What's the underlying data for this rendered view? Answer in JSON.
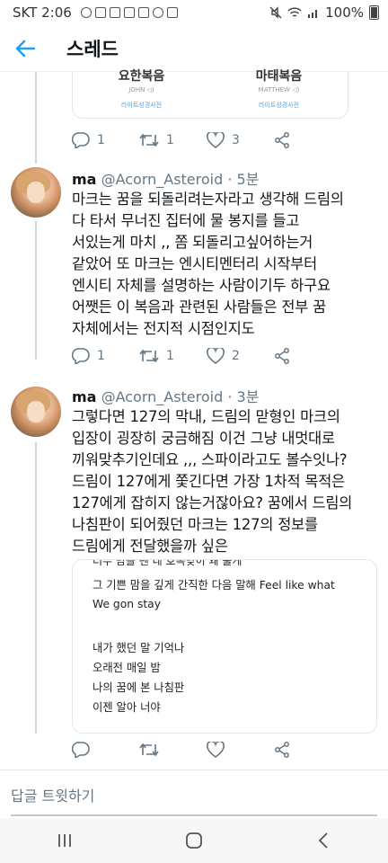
{
  "status_bar": {
    "carrier_time": "SKT 2:06",
    "battery_text": "100%",
    "icons_left": [
      "cloud-icon",
      "mail-icon",
      "calendar-icon",
      "cake-icon",
      "calendar-icon",
      "settings-icon",
      "gallery-icon"
    ],
    "icons_right": [
      "mute-icon",
      "wifi-icon",
      "signal-icon",
      "battery-icon"
    ]
  },
  "header": {
    "title": "스레드"
  },
  "prev_card": {
    "left": {
      "title": "요한복음",
      "sub": "JOHN ◁)",
      "link": "라이트성경사전"
    },
    "right": {
      "title": "마태복음",
      "sub": "MATTHEW ◁)",
      "link": "라이트성경사전"
    }
  },
  "actions_1": {
    "replies": "1",
    "retweets": "1",
    "likes": "3"
  },
  "tweet_1": {
    "name": "ma",
    "handle": "@Acorn_Asteroid",
    "dot": "·",
    "time": "5분",
    "lines": [
      "마크는 꿈을 되돌리려는자라고 생각해 드림의",
      "다 타서 무너진 집터에 물 봉지를 들고",
      "서있는게 마치 ,, 쫌 되돌리고싶어하는거",
      "같았어 또 마크는 엔시티멘터리 시작부터",
      "엔시티 자체를 설명하는 사람이기두 하구요",
      "어쨋든 이 복음과 관련된 사람들은 전부 꿈",
      "자체에서는 전지적 시점인지도"
    ]
  },
  "actions_2": {
    "replies": "1",
    "retweets": "1",
    "likes": "2"
  },
  "tweet_2": {
    "name": "ma",
    "handle": "@Acorn_Asteroid",
    "dot": "·",
    "time": "3분",
    "lines": [
      "그렇다면 127의 막내, 드림의 맏형인 마크의",
      "입장이 굉장히 궁금해짐 이건 그냥 내멋대로",
      "끼워맞추기인데요 ,,, 스파이라고도 볼수잇나?",
      "드림이 127에게 쫓긴다면 가장 1차적 목적은",
      "127에게 잡히지 않는거잖아요? 꿈에서 드림의",
      "나침판이 되어줬던 마크는 127의 정보를",
      "드림에게 전달했을까 싶은"
    ]
  },
  "attachment": {
    "cut_line": "너무 맘을 펜 네 호족낮이 왜 툴게",
    "lines": [
      "그 기쁜 맘을 깊게 간직한 다음 말해 Feel like what",
      "We gon stay",
      "",
      "내가 했던 말 기억나",
      "오래전 매일 밤",
      "나의 꿈에 본 나침판",
      "이젠 알아 너야"
    ]
  },
  "reply_bar": {
    "placeholder": "답글 트윗하기"
  },
  "colors": {
    "accent": "#1da1f2",
    "muted": "#657786",
    "border": "#e1e8ed"
  }
}
